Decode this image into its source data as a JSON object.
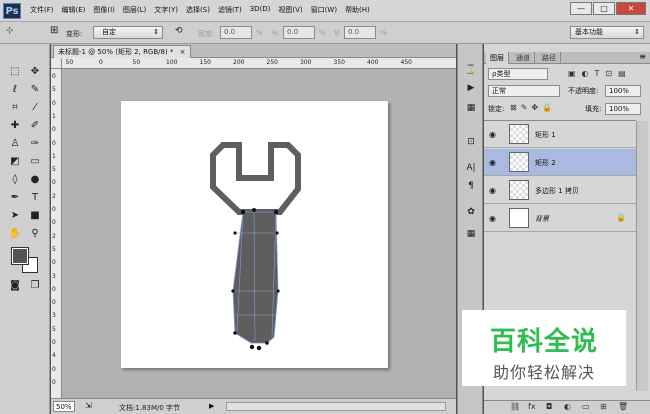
{
  "app": {
    "logo": "Ps"
  },
  "menu": {
    "items": [
      "文件(F)",
      "编辑(E)",
      "图像(I)",
      "图层(L)",
      "文字(Y)",
      "选择(S)",
      "滤镜(T)",
      "3D(D)",
      "视图(V)",
      "窗口(W)",
      "帮助(H)"
    ]
  },
  "window_controls": {
    "minimize": "—",
    "maximize": "□",
    "close": "✕"
  },
  "options": {
    "shape_label": "变形:",
    "shape_value": "自定",
    "w_label": "宽度:",
    "w_value": "0.0",
    "w_unit": "%",
    "h_label": "H:",
    "h_value": "0.0",
    "h_unit": "%",
    "v_label": "V:",
    "v_value": "0.0",
    "v_unit": "%",
    "workspace": "基本功能"
  },
  "document": {
    "tab_title": "未标题-1 @ 50% (矩形 2, RGB/8) *",
    "tab_close": "×",
    "ruler_top": [
      "100",
      "50",
      "0",
      "50",
      "100",
      "150",
      "200",
      "250",
      "300",
      "350",
      "400",
      "450"
    ],
    "ruler_left": [
      "0",
      "5",
      "0",
      "1",
      "0",
      "0",
      "1",
      "5",
      "0",
      "2",
      "0",
      "0",
      "2",
      "5",
      "0",
      "3",
      "0",
      "0",
      "3",
      "5",
      "0",
      "4",
      "0",
      "0"
    ]
  },
  "status": {
    "zoom": "50%",
    "doc_info": "文档:1.83M/0 字节"
  },
  "panel": {
    "tabs": [
      "图层",
      "通道",
      "路径"
    ],
    "filter_label": "ρ类型",
    "blend_mode": "正常",
    "opacity_label": "不透明度:",
    "opacity_value": "100%",
    "lock_label": "锁定:",
    "fill_label": "填充:",
    "fill_value": "100%",
    "layers": [
      {
        "name": "矩形 1",
        "visible": true,
        "selected": false,
        "thumb": "transparent"
      },
      {
        "name": "矩形 2",
        "visible": true,
        "selected": true,
        "thumb": "transparent"
      },
      {
        "name": "多边形 1 拷贝",
        "visible": true,
        "selected": false,
        "thumb": "transparent"
      },
      {
        "name": "背景",
        "visible": true,
        "selected": false,
        "thumb": "white",
        "locked": true
      }
    ]
  },
  "watermark": {
    "line1": "百科全说",
    "line2": "助你轻松解决"
  },
  "colors": {
    "foreground": "#555555",
    "background": "#ffffff",
    "shape": "#5e5e5e",
    "selection": "#a9b9df",
    "watermark_green": "#2fbd52"
  }
}
